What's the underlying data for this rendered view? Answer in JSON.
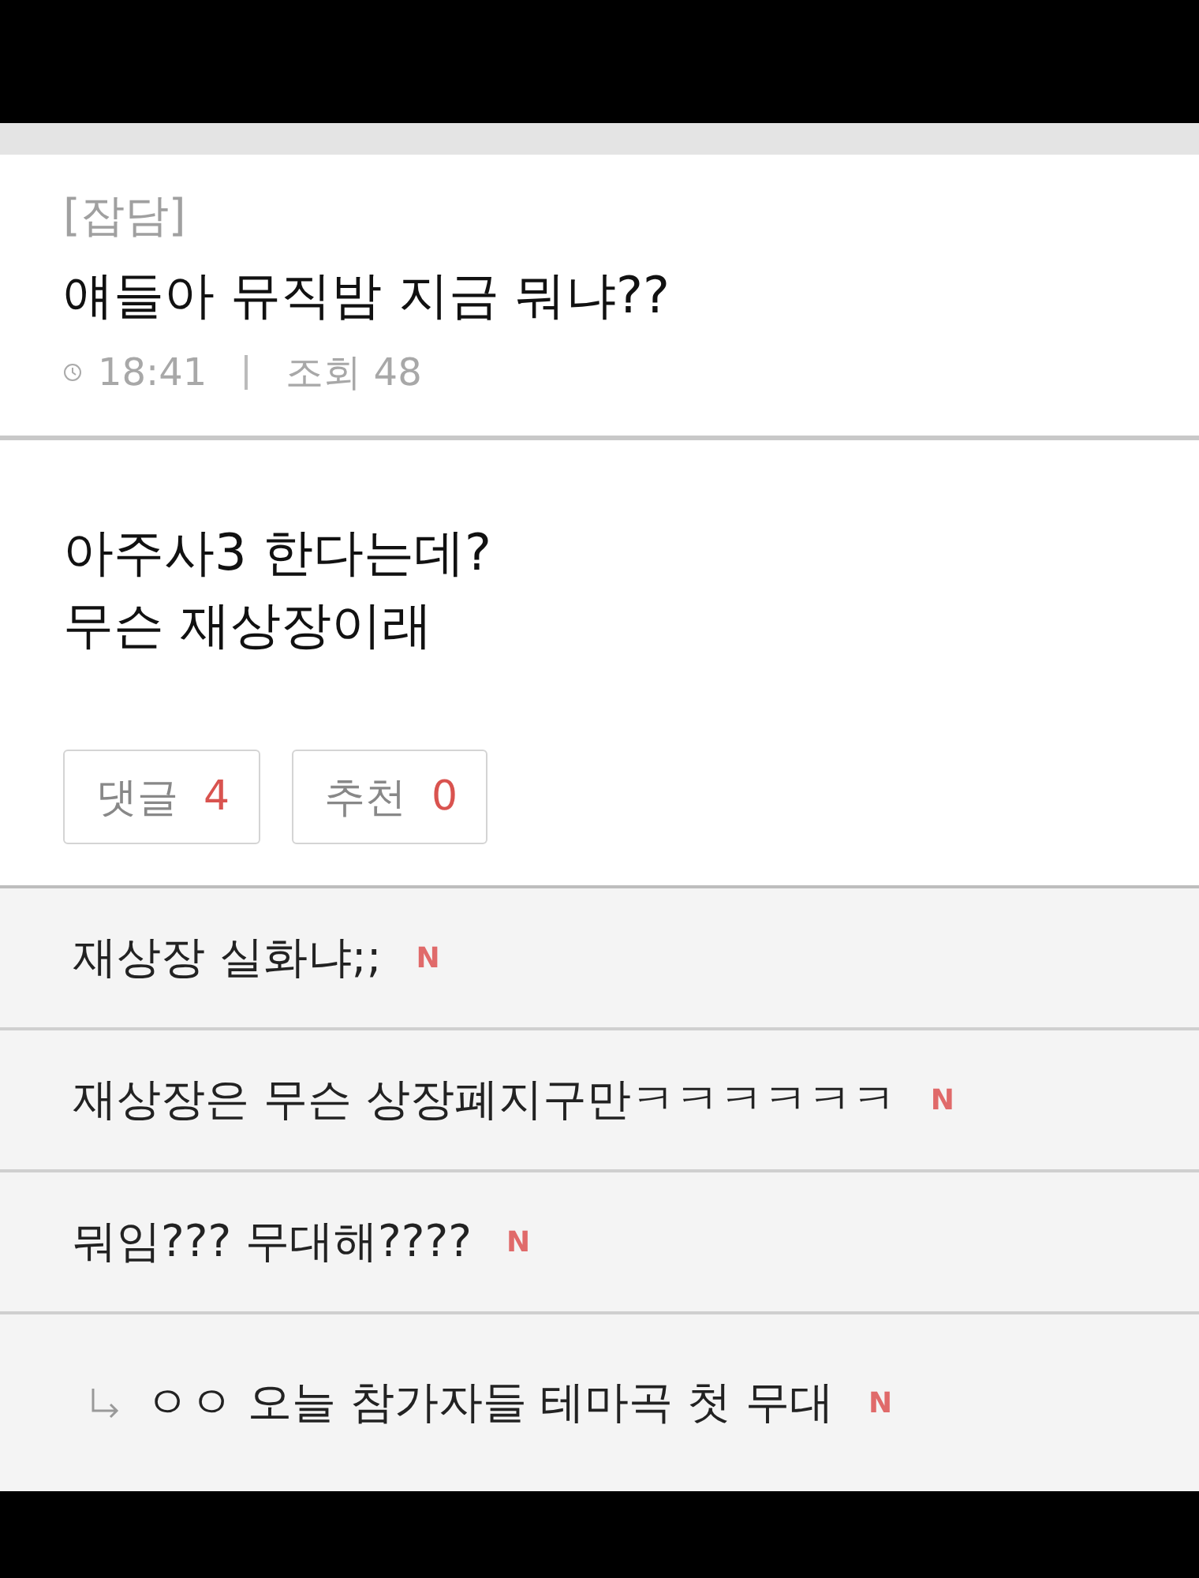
{
  "post": {
    "category": "[잡담]",
    "title": "얘들아 뮤직밤 지금 뭐냐??",
    "time": "18:41",
    "views": "조회 48",
    "body": [
      "아주사3 한다는데?",
      "무슨 재상장이래"
    ]
  },
  "actions": [
    {
      "label": "댓글",
      "count": "4"
    },
    {
      "label": "추천",
      "count": "0"
    }
  ],
  "comments": [
    {
      "kind": "comment",
      "text": "재상장 실화냐;;",
      "badge": "N"
    },
    {
      "kind": "comment",
      "text": "재상장은 무슨 상장폐지구만ㅋㅋㅋㅋㅋㅋ",
      "badge": "N"
    },
    {
      "kind": "comment",
      "text": "뭐임??? 무대해????",
      "badge": "N"
    },
    {
      "kind": "reply",
      "text": "ㅇㅇ 오늘 참가자들 테마곡 첫 무대",
      "badge": "N"
    }
  ]
}
